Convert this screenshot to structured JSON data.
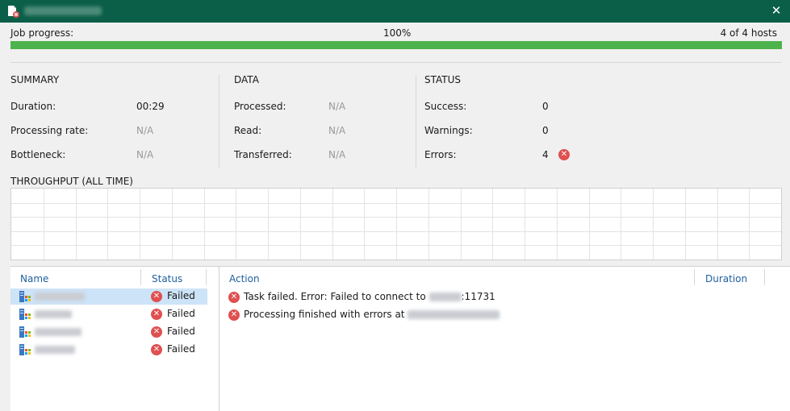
{
  "window": {
    "title": "",
    "close_glyph": "✕"
  },
  "progress": {
    "label": "Job progress:",
    "percent_text": "100%",
    "percent": 100,
    "hosts_text": "4 of 4 hosts"
  },
  "summary": {
    "title": "SUMMARY",
    "duration_label": "Duration:",
    "duration": "00:29",
    "rate_label": "Processing rate:",
    "rate": "N/A",
    "bottleneck_label": "Bottleneck:",
    "bottleneck": "N/A"
  },
  "data": {
    "title": "DATA",
    "processed_label": "Processed:",
    "processed": "N/A",
    "read_label": "Read:",
    "read": "N/A",
    "transferred_label": "Transferred:",
    "transferred": "N/A"
  },
  "status": {
    "title": "STATUS",
    "success_label": "Success:",
    "success": "0",
    "warnings_label": "Warnings:",
    "warnings": "0",
    "errors_label": "Errors:",
    "errors": "4"
  },
  "throughput": {
    "title": "THROUGHPUT (ALL TIME)"
  },
  "hosts_table": {
    "col_name": "Name",
    "col_status": "Status",
    "rows": [
      {
        "status": "Failed"
      },
      {
        "status": "Failed"
      },
      {
        "status": "Failed"
      },
      {
        "status": "Failed"
      }
    ]
  },
  "log": {
    "col_action": "Action",
    "col_duration": "Duration",
    "entries": [
      {
        "prefix": "Task failed. Error: Failed to connect to",
        "suffix": ":11731"
      },
      {
        "prefix": "Processing finished with errors at",
        "suffix": ""
      }
    ]
  },
  "colors": {
    "titlebar": "#0b5f48",
    "progress": "#4db34d",
    "error": "#e05050",
    "header_link": "#1f5f9f",
    "selection": "#cde3f7"
  }
}
